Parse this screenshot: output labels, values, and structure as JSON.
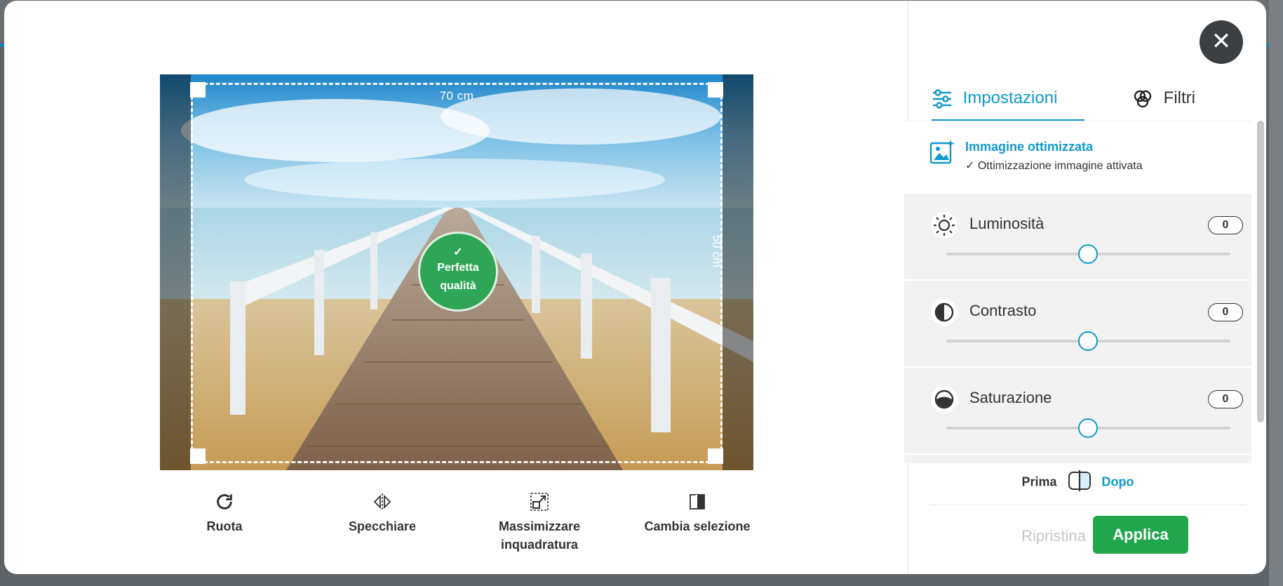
{
  "dialog": {
    "close_label": "✕"
  },
  "editor": {
    "width_label": "70 cm",
    "height_label": "50 cm",
    "quality_line1": "Perfetta",
    "quality_line2": "qualità",
    "quality_check": "✓"
  },
  "tools": [
    {
      "label": "Ruota",
      "icon": "rotate-icon"
    },
    {
      "label": "Specchiare",
      "icon": "mirror-icon"
    },
    {
      "label": "Massimizzare inquadratura",
      "label_line1": "Massimizzare",
      "label_line2": "inquadratura",
      "icon": "maximize-frame-icon"
    },
    {
      "label": "Cambia selezione",
      "icon": "change-selection-icon"
    }
  ],
  "panel": {
    "tabs": [
      {
        "label": "Impostazioni",
        "icon": "sliders-icon",
        "active": true
      },
      {
        "label": "Filtri",
        "icon": "filters-icon",
        "active": false
      }
    ],
    "optimized": {
      "title": "Immagine ottimizzata",
      "subtitle": "✓ Ottimizzazione immagine attivata",
      "icon": "magic-image-icon"
    },
    "adjustments": [
      {
        "label": "Luminosità",
        "value": "0",
        "icon": "brightness-icon"
      },
      {
        "label": "Contrasto",
        "value": "0",
        "icon": "contrast-icon"
      },
      {
        "label": "Saturazione",
        "value": "0",
        "icon": "saturation-icon"
      }
    ],
    "compare": {
      "before": "Prima",
      "after": "Dopo",
      "icon": "compare-icon"
    },
    "reset_label": "Ripristina",
    "apply_label": "Applica"
  },
  "colors": {
    "accent": "#1199cc",
    "apply": "#22a64c",
    "quality": "#2fa655",
    "close": "#3c3f42"
  }
}
